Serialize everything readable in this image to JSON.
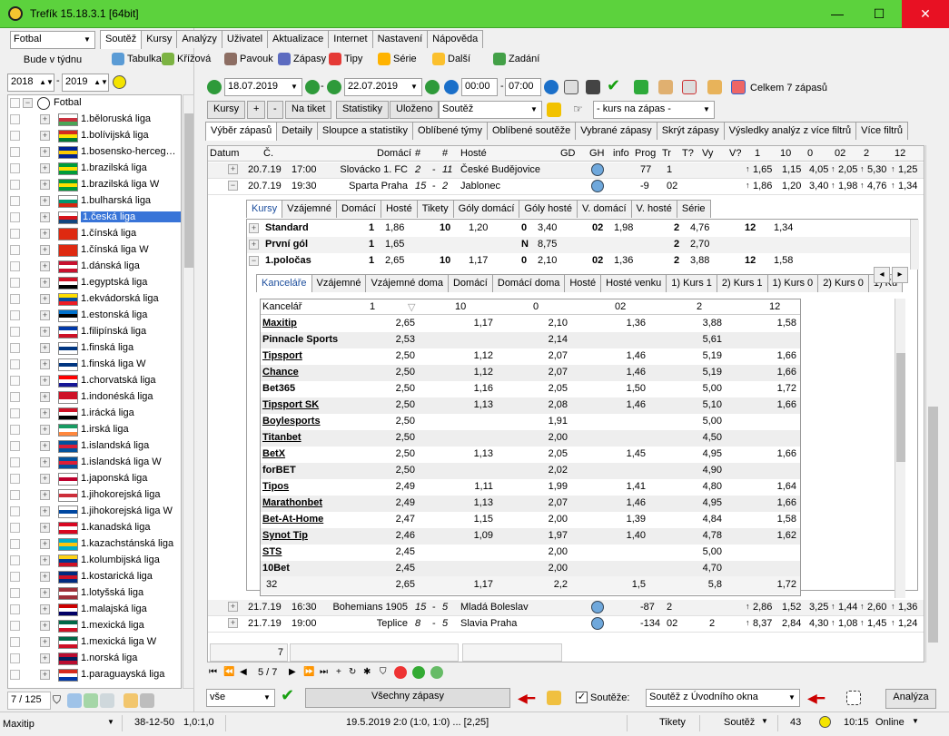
{
  "window": {
    "title": "Trefík 15.18.3.1 [64bit]",
    "min": "—",
    "max": "☐",
    "close": "✕"
  },
  "left": {
    "sport_select": "Fotbal",
    "period_button": "Bude v týdnu",
    "year_from": "2018",
    "year_to": "2019",
    "root_label": "Fotbal",
    "leagues": [
      {
        "label": "1.běloruská liga",
        "colors": [
          "#fff",
          "#c8313e",
          "#4aa657"
        ]
      },
      {
        "label": "1.bolívijská liga",
        "colors": [
          "#d52b1e",
          "#f9e300",
          "#007934"
        ]
      },
      {
        "label": "1.bosensko-herceg…",
        "colors": [
          "#002395",
          "#fecb00",
          "#002395"
        ]
      },
      {
        "label": "1.brazilská liga",
        "colors": [
          "#009c3b",
          "#ffdf00",
          "#009c3b"
        ]
      },
      {
        "label": "1.brazilská liga W",
        "colors": [
          "#009c3b",
          "#ffdf00",
          "#009c3b"
        ]
      },
      {
        "label": "1.bulharská liga",
        "colors": [
          "#fff",
          "#00966e",
          "#d62612"
        ]
      },
      {
        "label": "1.česká liga",
        "colors": [
          "#fff",
          "#d7141a",
          "#11457e"
        ],
        "selected": true
      },
      {
        "label": "1.čínská liga",
        "colors": [
          "#de2910",
          "#de2910",
          "#de2910"
        ]
      },
      {
        "label": "1.čínská liga W",
        "colors": [
          "#de2910",
          "#de2910",
          "#de2910"
        ]
      },
      {
        "label": "1.dánská liga",
        "colors": [
          "#c8102e",
          "#fff",
          "#c8102e"
        ]
      },
      {
        "label": "1.egyptská liga",
        "colors": [
          "#ce1126",
          "#fff",
          "#000"
        ]
      },
      {
        "label": "1.ekvádorská liga",
        "colors": [
          "#ffdd00",
          "#034ea2",
          "#ed1c24"
        ]
      },
      {
        "label": "1.estonská liga",
        "colors": [
          "#0072ce",
          "#000",
          "#fff"
        ]
      },
      {
        "label": "1.filipínská liga",
        "colors": [
          "#0038a8",
          "#fff",
          "#ce1126"
        ]
      },
      {
        "label": "1.finská liga",
        "colors": [
          "#fff",
          "#003580",
          "#fff"
        ]
      },
      {
        "label": "1.finská liga W",
        "colors": [
          "#fff",
          "#003580",
          "#fff"
        ]
      },
      {
        "label": "1.chorvatská liga",
        "colors": [
          "#ff0000",
          "#fff",
          "#171796"
        ]
      },
      {
        "label": "1.indonéská liga",
        "colors": [
          "#ce1126",
          "#ce1126",
          "#fff"
        ]
      },
      {
        "label": "1.irácká liga",
        "colors": [
          "#ce1126",
          "#fff",
          "#000"
        ]
      },
      {
        "label": "1.irská liga",
        "colors": [
          "#169b62",
          "#fff",
          "#ff883e"
        ]
      },
      {
        "label": "1.islandská liga",
        "colors": [
          "#02529c",
          "#dc1e35",
          "#02529c"
        ]
      },
      {
        "label": "1.islandská liga W",
        "colors": [
          "#02529c",
          "#dc1e35",
          "#02529c"
        ]
      },
      {
        "label": "1.japonská liga",
        "colors": [
          "#fff",
          "#bc002d",
          "#fff"
        ]
      },
      {
        "label": "1.jihokorejská liga",
        "colors": [
          "#fff",
          "#cd2e3a",
          "#fff"
        ]
      },
      {
        "label": "1.jihokorejská liga W",
        "colors": [
          "#fff",
          "#0047a0",
          "#fff"
        ]
      },
      {
        "label": "1.kanadská liga",
        "colors": [
          "#d80621",
          "#fff",
          "#d80621"
        ]
      },
      {
        "label": "1.kazachstánská liga",
        "colors": [
          "#00afca",
          "#fec50c",
          "#00afca"
        ]
      },
      {
        "label": "1.kolumbijská liga",
        "colors": [
          "#fcd116",
          "#003893",
          "#ce1126"
        ]
      },
      {
        "label": "1.kostarická liga",
        "colors": [
          "#002b7f",
          "#ce1126",
          "#002b7f"
        ]
      },
      {
        "label": "1.lotyšská liga",
        "colors": [
          "#9e3039",
          "#fff",
          "#9e3039"
        ]
      },
      {
        "label": "1.malajská liga",
        "colors": [
          "#cc0001",
          "#fff",
          "#010066"
        ]
      },
      {
        "label": "1.mexická liga",
        "colors": [
          "#006847",
          "#fff",
          "#ce1126"
        ]
      },
      {
        "label": "1.mexická liga W",
        "colors": [
          "#006847",
          "#fff",
          "#ce1126"
        ]
      },
      {
        "label": "1.norská liga",
        "colors": [
          "#ba0c2f",
          "#00205b",
          "#ba0c2f"
        ]
      },
      {
        "label": "1.paraguayská liga",
        "colors": [
          "#d52b1e",
          "#fff",
          "#0038a8"
        ]
      }
    ],
    "count": "7 / 125"
  },
  "menu_tabs": [
    "Soutěž",
    "Kursy",
    "Analýzy",
    "Uživatel",
    "Aktualizace",
    "Internet",
    "Nastavení",
    "Nápověda"
  ],
  "toolbar1": [
    "Tabulka",
    "Křížová",
    "Pavouk",
    "Zápasy",
    "Tipy",
    "Série",
    "Další",
    "Zadání"
  ],
  "dates": {
    "from": "18.07.2019",
    "to": "22.07.2019",
    "time_from": "00:00",
    "time_to": "07:00",
    "total": "Celkem 7 zápasů"
  },
  "toolbar3": {
    "kursy": "Kursy",
    "plus": "+",
    "minus": "-",
    "tiket": "Na tiket",
    "stats": "Statistiky",
    "saved": "Uloženo",
    "competition": "Soutěž",
    "odds_filter": "- kurs na zápas -"
  },
  "view_tabs": [
    "Výběr zápasů",
    "Detaily",
    "Sloupce a statistiky",
    "Oblíbené týmy",
    "Oblíbené soutěže",
    "Vybrané zápasy",
    "Skrýt zápasy",
    "Výsledky analýz z více filtrů",
    "Více filtrů"
  ],
  "grid_headers": [
    "Datum",
    "Č.",
    "Domácí",
    "#",
    "#",
    "Hosté",
    "GD",
    "GH",
    "info",
    "Prog",
    "Tr",
    "T?",
    "Vy",
    "V?",
    "1",
    "10",
    "0",
    "02",
    "2",
    "12"
  ],
  "matches": [
    {
      "date": "20.7.19",
      "time": "17:00",
      "home": "Slovácko 1. FC",
      "r1": "2",
      "r2": "11",
      "away": "České Budějovice",
      "prog": "77",
      "tr": "1",
      "o1": "1,65",
      "o10": "1,15",
      "o0": "4,05",
      "o02": "2,05",
      "o2": "5,30",
      "o12": "1,25"
    },
    {
      "date": "20.7.19",
      "time": "19:30",
      "home": "Sparta Praha",
      "r1": "15",
      "r2": "2",
      "away": "Jablonec",
      "prog": "-9",
      "tr": "02",
      "o1": "1,86",
      "o10": "1,20",
      "o0": "3,40",
      "o02": "1,98",
      "o2": "4,76",
      "o12": "1,34"
    },
    {
      "date": "21.7.19",
      "time": "16:30",
      "home": "Bohemians 1905",
      "r1": "15",
      "r2": "5",
      "away": "Mladá Boleslav",
      "prog": "-87",
      "tr": "2",
      "o1": "2,86",
      "o10": "1,52",
      "o0": "3,25",
      "o02": "1,44",
      "o2": "2,60",
      "o12": "1,36"
    },
    {
      "date": "21.7.19",
      "time": "19:00",
      "home": "Teplice",
      "r1": "8",
      "r2": "5",
      "away": "Slavia Praha",
      "prog": "-134",
      "tr": "02",
      "vy": "2",
      "o1": "8,37",
      "o10": "2,84",
      "o0": "4,30",
      "o02": "1,08",
      "o2": "1,45",
      "o12": "1,24"
    }
  ],
  "detail_tabs": [
    "Kursy",
    "Vzájemné",
    "Domácí",
    "Hosté",
    "Tikety",
    "Góly domácí",
    "Góly hosté",
    "V. domácí",
    "V. hosté",
    "Série"
  ],
  "markets": [
    {
      "name": "Standard",
      "c1": "1",
      "v1": "1,86",
      "c2": "10",
      "v2": "1,20",
      "c3": "0",
      "v3": "3,40",
      "c4": "02",
      "v4": "1,98",
      "c5": "2",
      "v5": "4,76",
      "c6": "12",
      "v6": "1,34"
    },
    {
      "name": "První gól",
      "c1": "1",
      "v1": "1,65",
      "c2": "",
      "v2": "",
      "c3": "N",
      "v3": "8,75",
      "c4": "",
      "v4": "",
      "c5": "2",
      "v5": "2,70",
      "c6": "",
      "v6": ""
    },
    {
      "name": "1.poločas",
      "c1": "1",
      "v1": "2,65",
      "c2": "10",
      "v2": "1,17",
      "c3": "0",
      "v3": "2,10",
      "c4": "02",
      "v4": "1,36",
      "c5": "2",
      "v5": "3,88",
      "c6": "12",
      "v6": "1,58"
    }
  ],
  "book_tabs": [
    "Kanceláře",
    "Vzájemné",
    "Vzájemné doma",
    "Domácí",
    "Domácí doma",
    "Hosté",
    "Hosté venku",
    "1) Kurs 1",
    "2) Kurs 1",
    "1) Kurs 0",
    "2) Kurs 0",
    "1) Ku"
  ],
  "book_headers": [
    "Kancelář",
    "1",
    "10",
    "0",
    "02",
    "2",
    "12"
  ],
  "bookmakers": [
    {
      "name": "Maxitip",
      "u": true,
      "v": [
        "2,65",
        "1,17",
        "2,10",
        "1,36",
        "3,88",
        "1,58"
      ]
    },
    {
      "name": "Pinnacle Sports",
      "u": false,
      "v": [
        "2,53",
        "",
        "2,14",
        "",
        "5,61",
        ""
      ]
    },
    {
      "name": "Tipsport",
      "u": true,
      "v": [
        "2,50",
        "1,12",
        "2,07",
        "1,46",
        "5,19",
        "1,66"
      ]
    },
    {
      "name": "Chance",
      "u": true,
      "v": [
        "2,50",
        "1,12",
        "2,07",
        "1,46",
        "5,19",
        "1,66"
      ]
    },
    {
      "name": "Bet365",
      "u": false,
      "v": [
        "2,50",
        "1,16",
        "2,05",
        "1,50",
        "5,00",
        "1,72"
      ]
    },
    {
      "name": "Tipsport SK",
      "u": true,
      "v": [
        "2,50",
        "1,13",
        "2,08",
        "1,46",
        "5,10",
        "1,66"
      ]
    },
    {
      "name": "Boylesports",
      "u": true,
      "v": [
        "2,50",
        "",
        "1,91",
        "",
        "5,00",
        ""
      ]
    },
    {
      "name": "Titanbet",
      "u": true,
      "v": [
        "2,50",
        "",
        "2,00",
        "",
        "4,50",
        ""
      ]
    },
    {
      "name": "BetX",
      "u": true,
      "v": [
        "2,50",
        "1,13",
        "2,05",
        "1,45",
        "4,95",
        "1,66"
      ]
    },
    {
      "name": "forBET",
      "u": false,
      "v": [
        "2,50",
        "",
        "2,02",
        "",
        "4,90",
        ""
      ]
    },
    {
      "name": "Tipos",
      "u": true,
      "v": [
        "2,49",
        "1,11",
        "1,99",
        "1,41",
        "4,80",
        "1,64"
      ]
    },
    {
      "name": "Marathonbet",
      "u": true,
      "v": [
        "2,49",
        "1,13",
        "2,07",
        "1,46",
        "4,95",
        "1,66"
      ]
    },
    {
      "name": "Bet-At-Home",
      "u": true,
      "v": [
        "2,47",
        "1,15",
        "2,00",
        "1,39",
        "4,84",
        "1,58"
      ]
    },
    {
      "name": "Synot Tip",
      "u": true,
      "v": [
        "2,46",
        "1,09",
        "1,97",
        "1,40",
        "4,78",
        "1,62"
      ]
    },
    {
      "name": "STS",
      "u": true,
      "v": [
        "2,45",
        "",
        "2,00",
        "",
        "5,00",
        ""
      ]
    },
    {
      "name": "10Bet",
      "u": false,
      "v": [
        "2,45",
        "",
        "2,00",
        "",
        "4,70",
        ""
      ]
    }
  ],
  "book_footer": [
    "32",
    "2,65",
    "1,17",
    "2,2",
    "1,5",
    "5,8",
    "1,72"
  ],
  "grid_footer_count": "7",
  "pager": "5 / 7",
  "bottom": {
    "filter": "vše",
    "all_matches": "Všechny zápasy",
    "chk_label": "Soutěže:",
    "source": "Soutěž z Úvodního okna",
    "analyze": "Analýza"
  },
  "status": {
    "left": "Maxitip",
    "s1": "38-12-50",
    "s2": "1,0:1,0",
    "s3": "19.5.2019 2:0 (1:0, 1:0) ... [2,25]",
    "s4": "Tikety",
    "s5": "Soutěž",
    "s6": "43",
    "s7": "10:15",
    "s8": "Online"
  }
}
